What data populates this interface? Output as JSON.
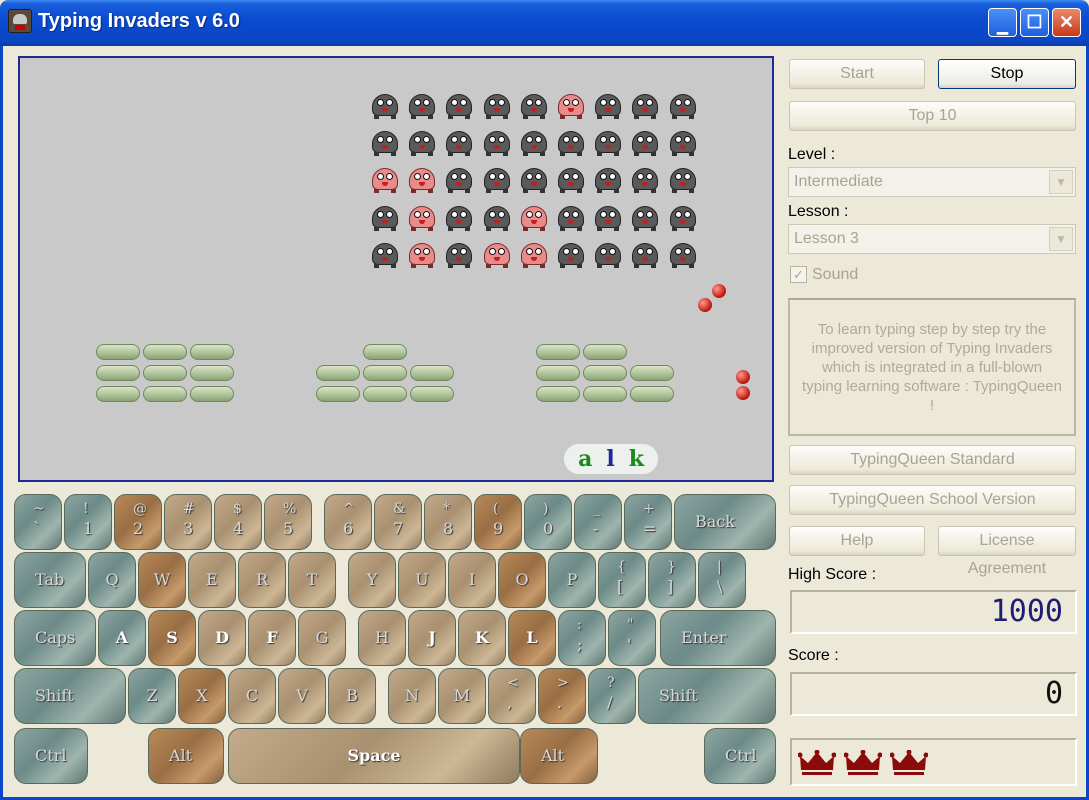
{
  "window": {
    "title": "Typing Invaders v 6.0",
    "min_glyph": "▁",
    "max_glyph": "☐",
    "close_glyph": "✕"
  },
  "game": {
    "typing_chars": [
      "a",
      "l",
      "k"
    ],
    "invader_rows": [
      [
        "gray",
        "gray",
        "gray",
        "gray",
        "gray",
        "pink",
        "gray",
        "gray",
        "gray"
      ],
      [
        "gray",
        "gray",
        "gray",
        "gray",
        "gray",
        "gray",
        "gray",
        "gray",
        "gray"
      ],
      [
        "pink",
        "pink",
        "gray",
        "gray",
        "gray",
        "gray",
        "gray",
        "gray",
        "gray"
      ],
      [
        "gray",
        "pink",
        "gray",
        "gray",
        "pink",
        "gray",
        "gray",
        "gray",
        "gray"
      ],
      [
        "gray",
        "pink",
        "gray",
        "pink",
        "pink",
        "gray",
        "gray",
        "gray",
        "gray"
      ]
    ]
  },
  "keyboard": {
    "rows": [
      [
        {
          "name": "tilde",
          "shift": "~",
          "main": "`",
          "color": "gray"
        },
        {
          "name": "1",
          "shift": "!",
          "main": "1",
          "color": "gray"
        },
        {
          "name": "2",
          "shift": "@",
          "main": "2",
          "color": "brown"
        },
        {
          "name": "3",
          "shift": "#",
          "main": "3",
          "color": "tan"
        },
        {
          "name": "4",
          "shift": "$",
          "main": "4",
          "color": "tan"
        },
        {
          "name": "5",
          "shift": "%",
          "main": "5",
          "color": "tan"
        },
        {
          "name": "6",
          "shift": "^",
          "main": "6",
          "color": "tan"
        },
        {
          "name": "7",
          "shift": "&",
          "main": "7",
          "color": "tan"
        },
        {
          "name": "8",
          "shift": "*",
          "main": "8",
          "color": "tan"
        },
        {
          "name": "9",
          "shift": "(",
          "main": "9",
          "color": "brown"
        },
        {
          "name": "0",
          "shift": ")",
          "main": "0",
          "color": "gray"
        },
        {
          "name": "minus",
          "shift": "_",
          "main": "-",
          "color": "gray"
        },
        {
          "name": "equals",
          "shift": "+",
          "main": "=",
          "color": "gray"
        },
        {
          "name": "backspace",
          "label": "Back",
          "color": "gray"
        }
      ],
      [
        {
          "name": "tab",
          "label": "Tab",
          "color": "gray"
        },
        {
          "name": "q",
          "label": "Q",
          "color": "gray"
        },
        {
          "name": "w",
          "label": "W",
          "color": "brown"
        },
        {
          "name": "e",
          "label": "E",
          "color": "tan"
        },
        {
          "name": "r",
          "label": "R",
          "color": "tan"
        },
        {
          "name": "t",
          "label": "T",
          "color": "tan"
        },
        {
          "name": "y",
          "label": "Y",
          "color": "tan"
        },
        {
          "name": "u",
          "label": "U",
          "color": "tan"
        },
        {
          "name": "i",
          "label": "I",
          "color": "tan"
        },
        {
          "name": "o",
          "label": "O",
          "color": "brown"
        },
        {
          "name": "p",
          "label": "P",
          "color": "gray"
        },
        {
          "name": "bracket-left",
          "shift": "{",
          "main": "[",
          "color": "gray"
        },
        {
          "name": "bracket-right",
          "shift": "}",
          "main": "]",
          "color": "gray"
        },
        {
          "name": "backslash",
          "shift": "|",
          "main": "\\",
          "color": "gray"
        }
      ],
      [
        {
          "name": "caps",
          "label": "Caps",
          "color": "gray"
        },
        {
          "name": "a",
          "label": "A",
          "color": "gray",
          "hot": true
        },
        {
          "name": "s",
          "label": "S",
          "color": "brown",
          "hot": true
        },
        {
          "name": "d",
          "label": "D",
          "color": "tan",
          "hot": true
        },
        {
          "name": "f",
          "label": "F",
          "color": "tan",
          "hot": true
        },
        {
          "name": "g",
          "label": "G",
          "color": "tan"
        },
        {
          "name": "h",
          "label": "H",
          "color": "tan"
        },
        {
          "name": "j",
          "label": "J",
          "color": "tan",
          "hot": true
        },
        {
          "name": "k",
          "label": "K",
          "color": "tan",
          "hot": true
        },
        {
          "name": "l",
          "label": "L",
          "color": "brown",
          "hot": true
        },
        {
          "name": "semicolon",
          "shift": ":",
          "main": ";",
          "color": "gray",
          "hot": true
        },
        {
          "name": "quote",
          "shift": "\"",
          "main": "'",
          "color": "gray"
        },
        {
          "name": "enter",
          "label": "Enter",
          "color": "gray"
        }
      ],
      [
        {
          "name": "shift-left",
          "label": "Shift",
          "color": "gray"
        },
        {
          "name": "z",
          "label": "Z",
          "color": "gray"
        },
        {
          "name": "x",
          "label": "X",
          "color": "brown"
        },
        {
          "name": "c",
          "label": "C",
          "color": "tan"
        },
        {
          "name": "v",
          "label": "V",
          "color": "tan"
        },
        {
          "name": "b",
          "label": "B",
          "color": "tan"
        },
        {
          "name": "n",
          "label": "N",
          "color": "tan"
        },
        {
          "name": "m",
          "label": "M",
          "color": "tan"
        },
        {
          "name": "comma",
          "shift": "<",
          "main": ",",
          "color": "tan"
        },
        {
          "name": "period",
          "shift": ">",
          "main": ".",
          "color": "brown"
        },
        {
          "name": "slash",
          "shift": "?",
          "main": "/",
          "color": "gray"
        },
        {
          "name": "shift-right",
          "label": "Shift",
          "color": "gray"
        }
      ],
      [
        {
          "name": "ctrl-left",
          "label": "Ctrl",
          "color": "gray"
        },
        {
          "name": "alt-left",
          "label": "Alt",
          "color": "brown"
        },
        {
          "name": "space",
          "label": "Space",
          "color": "tan",
          "hot": true
        },
        {
          "name": "alt-right",
          "label": "Alt",
          "color": "brown"
        },
        {
          "name": "ctrl-right",
          "label": "Ctrl",
          "color": "gray"
        }
      ]
    ]
  },
  "panel": {
    "start_label": "Start",
    "stop_label": "Stop",
    "top10_label": "Top 10",
    "level_label": "Level :",
    "level_value": "Intermediate",
    "lesson_label": "Lesson :",
    "lesson_value": "Lesson 3",
    "sound_label": "Sound",
    "sound_check": "✓",
    "combo_arrow": "▼",
    "info_text": "To learn typing step by step try the improved version of Typing Invaders which is integrated in a full-blown typing learning software : TypingQueen !",
    "tq_standard_label": "TypingQueen Standard",
    "tq_school_label": "TypingQueen School Version",
    "help_label": "Help",
    "license_label": "License Agreement",
    "high_score_label": "High Score :",
    "high_score_value": "1000",
    "score_label": "Score :",
    "score_value": "0",
    "lives": 3
  },
  "colors": {
    "title_blue": "#0a4cd2",
    "game_bg": "#c9c9c9",
    "crown": "#8b0a0a",
    "high_score": "#1e1e78"
  }
}
